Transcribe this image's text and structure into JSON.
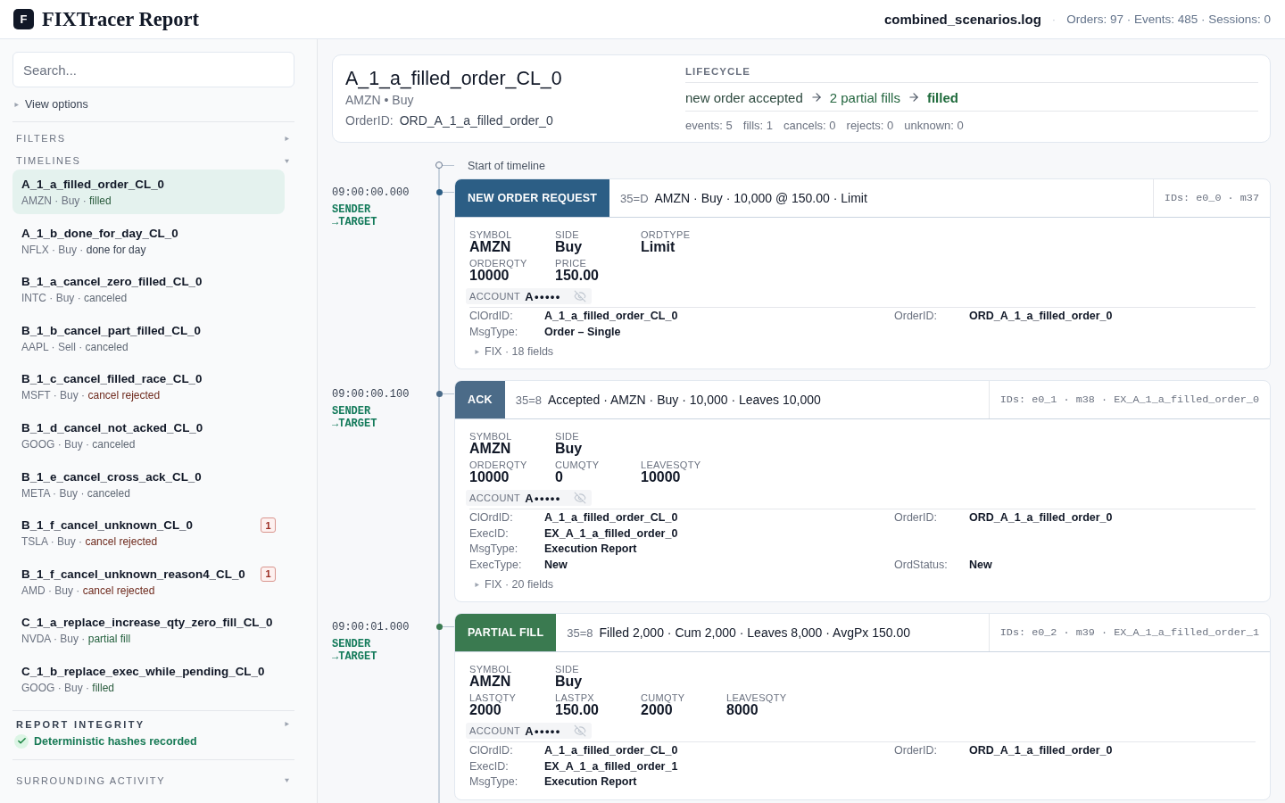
{
  "header": {
    "logo_letter": "F",
    "title": "FIXTracer Report",
    "file": "combined_scenarios.log",
    "separator": "·",
    "stats": "Orders: 97 · Events: 485 · Sessions: 0"
  },
  "sidebar": {
    "search": {
      "placeholder": "Search..."
    },
    "view_options": {
      "label": "View options",
      "expanded": false
    },
    "filters": {
      "title": "FILTERS",
      "expanded": false
    },
    "timelines": {
      "title": "TIMELINES",
      "expanded": true,
      "items": [
        {
          "name": "A_1_a_filled_order_CL_0",
          "meta": "AMZN · Buy ·",
          "status": {
            "label": "filled",
            "color": "#2b5c3e"
          },
          "selected": true
        },
        {
          "name": "A_1_b_done_for_day_CL_0",
          "meta": "NFLX · Buy ·",
          "status": {
            "label": "done for day",
            "color": "#374151"
          },
          "selected": false
        },
        {
          "name": "B_1_a_cancel_zero_filled_CL_0",
          "meta": "INTC · Buy ·",
          "status": {
            "label": "canceled",
            "color": "#5f6874"
          },
          "selected": false
        },
        {
          "name": "B_1_b_cancel_part_filled_CL_0",
          "meta": "AAPL · Sell ·",
          "status": {
            "label": "canceled",
            "color": "#5f6874"
          },
          "selected": false
        },
        {
          "name": "B_1_c_cancel_filled_race_CL_0",
          "meta": "MSFT · Buy ·",
          "status": {
            "label": "cancel rejected",
            "color": "#6e2a1d"
          },
          "selected": false
        },
        {
          "name": "B_1_d_cancel_not_acked_CL_0",
          "meta": "GOOG · Buy ·",
          "status": {
            "label": "canceled",
            "color": "#5f6874"
          },
          "selected": false
        },
        {
          "name": "B_1_e_cancel_cross_ack_CL_0",
          "meta": "META · Buy ·",
          "status": {
            "label": "canceled",
            "color": "#5f6874"
          },
          "selected": false
        },
        {
          "name": "B_1_f_cancel_unknown_CL_0",
          "meta": "TSLA · Buy ·",
          "status": {
            "label": "cancel rejected",
            "color": "#6e2a1d"
          },
          "badge": "1",
          "selected": false
        },
        {
          "name": "B_1_f_cancel_unknown_reason4_CL_0",
          "meta": "AMD · Buy ·",
          "status": {
            "label": "cancel rejected",
            "color": "#6e2a1d"
          },
          "badge": "1",
          "selected": false
        },
        {
          "name": "C_1_a_replace_increase_qty_zero_fill_CL_0",
          "meta": "NVDA · Buy ·",
          "status": {
            "label": "partial fill",
            "color": "#23603d"
          },
          "selected": false
        },
        {
          "name": "C_1_b_replace_exec_while_pending_CL_0",
          "meta": "GOOG · Buy ·",
          "status": {
            "label": "filled",
            "color": "#2b5c3e"
          },
          "selected": false
        }
      ]
    },
    "report_integrity": {
      "title": "REPORT INTEGRITY",
      "expanded": false,
      "status": "Deterministic hashes recorded"
    },
    "surrounding_activity": {
      "title": "SURROUNDING ACTIVITY",
      "expanded": true
    }
  },
  "summary": {
    "title": "A_1_a_filled_order_CL_0",
    "subtitle": "AMZN • Buy",
    "order_id": {
      "label": "OrderID:",
      "value": "ORD_A_1_a_filled_order_0"
    },
    "lifecycle": {
      "title": "LIFECYCLE",
      "steps": [
        {
          "label": "new order accepted",
          "color": "#2f4b40",
          "bold": false
        },
        {
          "label": "2 partial fills",
          "color": "#24663f",
          "bold": false
        },
        {
          "label": "filled",
          "color": "#1f6b3c",
          "bold": true
        }
      ],
      "stats": [
        "events: 5",
        "fills: 1",
        "cancels: 0",
        "rejects: 0",
        "unknown: 0"
      ]
    }
  },
  "timeline": {
    "start_label": "Start of timeline",
    "events": [
      {
        "time": "09:00:00.000",
        "sender": "SENDER",
        "target": "→TARGET",
        "type": "NEW ORDER REQUEST",
        "color": "#2c5e85",
        "msg_type": "35=D",
        "summary": "AMZN · Buy · 10,000 @ 150.00 · Limit",
        "ids": "IDs: e0_0 · m37",
        "field_rows": [
          [
            {
              "label": "SYMBOL",
              "value": "AMZN"
            },
            {
              "label": "SIDE",
              "value": "Buy"
            },
            {
              "label": "ORDTYPE",
              "value": "Limit"
            }
          ],
          [
            {
              "label": "ORDERQTY",
              "value": "10000"
            },
            {
              "label": "PRICE",
              "value": "150.00"
            }
          ]
        ],
        "account": {
          "label": "ACCOUNT",
          "value": "A•••••",
          "masked": true
        },
        "details": [
          [
            {
              "label": "ClOrdID:",
              "value": "A_1_a_filled_order_CL_0"
            },
            {
              "label": "OrderID:",
              "value": "ORD_A_1_a_filled_order_0"
            }
          ],
          [
            {
              "label": "MsgType:",
              "value": "Order – Single"
            }
          ]
        ],
        "fix": {
          "label": "FIX · 18 fields",
          "expanded": false
        }
      },
      {
        "time": "09:00:00.100",
        "sender": "SENDER",
        "target": "→TARGET",
        "type": "ACK",
        "color": "#4b6b88",
        "msg_type": "35=8",
        "summary": "Accepted · AMZN · Buy · 10,000 · Leaves 10,000",
        "ids": "IDs: e0_1 · m38 · EX_A_1_a_filled_order_0",
        "field_rows": [
          [
            {
              "label": "SYMBOL",
              "value": "AMZN"
            },
            {
              "label": "SIDE",
              "value": "Buy"
            }
          ],
          [
            {
              "label": "ORDERQTY",
              "value": "10000"
            },
            {
              "label": "CUMQTY",
              "value": "0"
            },
            {
              "label": "LEAVESQTY",
              "value": "10000"
            }
          ]
        ],
        "account": {
          "label": "ACCOUNT",
          "value": "A•••••",
          "masked": true
        },
        "details": [
          [
            {
              "label": "ClOrdID:",
              "value": "A_1_a_filled_order_CL_0"
            },
            {
              "label": "OrderID:",
              "value": "ORD_A_1_a_filled_order_0"
            }
          ],
          [
            {
              "label": "ExecID:",
              "value": "EX_A_1_a_filled_order_0"
            }
          ],
          [
            {
              "label": "MsgType:",
              "value": "Execution Report"
            }
          ],
          [
            {
              "label": "ExecType:",
              "value": "New"
            },
            {
              "label": "OrdStatus:",
              "value": "New"
            }
          ]
        ],
        "fix": {
          "label": "FIX · 20 fields",
          "expanded": false
        }
      },
      {
        "time": "09:00:01.000",
        "sender": "SENDER",
        "target": "→TARGET",
        "type": "PARTIAL FILL",
        "color": "#3a7a50",
        "msg_type": "35=8",
        "summary": "Filled 2,000 · Cum 2,000 · Leaves 8,000 · AvgPx 150.00",
        "ids": "IDs: e0_2 · m39 · EX_A_1_a_filled_order_1",
        "field_rows": [
          [
            {
              "label": "SYMBOL",
              "value": "AMZN"
            },
            {
              "label": "SIDE",
              "value": "Buy"
            }
          ],
          [
            {
              "label": "LASTQTY",
              "value": "2000"
            },
            {
              "label": "LASTPX",
              "value": "150.00"
            },
            {
              "label": "CUMQTY",
              "value": "2000"
            },
            {
              "label": "LEAVESQTY",
              "value": "8000"
            }
          ]
        ],
        "account": {
          "label": "ACCOUNT",
          "value": "A•••••",
          "masked": true
        },
        "details": [
          [
            {
              "label": "ClOrdID:",
              "value": "A_1_a_filled_order_CL_0"
            },
            {
              "label": "OrderID:",
              "value": "ORD_A_1_a_filled_order_0"
            }
          ],
          [
            {
              "label": "ExecID:",
              "value": "EX_A_1_a_filled_order_1"
            }
          ],
          [
            {
              "label": "MsgType:",
              "value": "Execution Report"
            }
          ]
        ]
      }
    ]
  }
}
